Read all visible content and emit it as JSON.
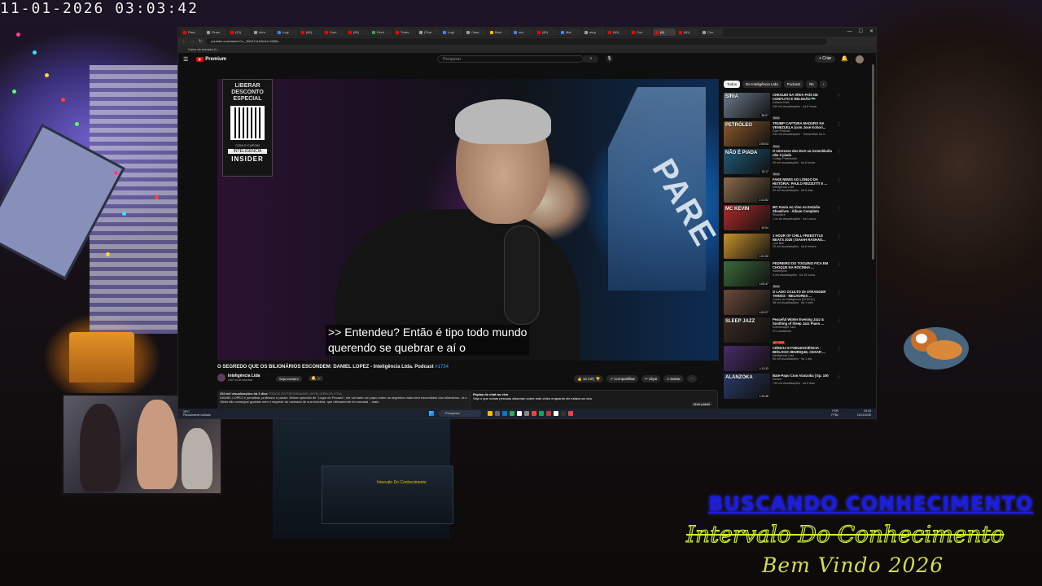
{
  "scene": {
    "timestamp": "11-01-2026 03:03:42",
    "overlay_line1": "BUSCANDO CONHECIMENTO",
    "overlay_line2": "Intervalo Do Conhecimento",
    "overlay_line3": "Bem Vindo 2026",
    "desk_monitor_text": "Intervalo Do Conhecimento"
  },
  "browser": {
    "tabs": [
      {
        "label": "Para",
        "icon": "youtube-icon",
        "color": "#ff0000"
      },
      {
        "label": "Finan",
        "icon": "page-icon",
        "color": "#9aa0a6"
      },
      {
        "label": "(23)",
        "icon": "youtube-icon",
        "color": "#ff0000"
      },
      {
        "label": "Intro",
        "icon": "page-icon",
        "color": "#9aa0a6"
      },
      {
        "label": "Logi",
        "icon": "page-icon",
        "color": "#4285f4"
      },
      {
        "label": "(80)",
        "icon": "youtube-icon",
        "color": "#ff0000"
      },
      {
        "label": "Com",
        "icon": "youtube-icon",
        "color": "#ff0000"
      },
      {
        "label": "(80)",
        "icon": "youtube-icon",
        "color": "#ff0000"
      },
      {
        "label": "Escri",
        "icon": "page-icon",
        "color": "#34a853"
      },
      {
        "label": "Trans",
        "icon": "youtube-icon",
        "color": "#ff0000"
      },
      {
        "label": "(Tina",
        "icon": "page-icon",
        "color": "#9aa0a6"
      },
      {
        "label": "Logi",
        "icon": "page-icon",
        "color": "#4285f4"
      },
      {
        "label": "Casa",
        "icon": "page-icon",
        "color": "#9aa0a6"
      },
      {
        "label": "Bem",
        "icon": "page-icon",
        "color": "#fbbc05"
      },
      {
        "label": "soc",
        "icon": "page-icon",
        "color": "#4285f4"
      },
      {
        "label": "(80)",
        "icon": "youtube-icon",
        "color": "#ff0000"
      },
      {
        "label": "Mal",
        "icon": "page-icon",
        "color": "#4285f4"
      },
      {
        "label": "aw.p",
        "icon": "page-icon",
        "color": "#9aa0a6"
      },
      {
        "label": "(80)",
        "icon": "youtube-icon",
        "color": "#ff0000"
      },
      {
        "label": "Con",
        "icon": "youtube-icon",
        "color": "#ff0000"
      },
      {
        "label": "(8)",
        "icon": "youtube-icon",
        "color": "#ff0000",
        "active": true
      },
      {
        "label": "(80)",
        "icon": "youtube-icon",
        "color": "#ff0000"
      },
      {
        "label": "Con",
        "icon": "page-icon",
        "color": "#9aa0a6"
      }
    ],
    "url": "youtube.com/watch?v=_RW474LN9c&t=1580s",
    "bookmark": "Caixa de entrada (1..."
  },
  "youtube": {
    "logo_text": "Premium",
    "search_placeholder": "Pesquisar",
    "create_label": "+ Criar",
    "notifications_badge": "9+",
    "video": {
      "promo_title": "LIBERAR DESCONTO ESPECIAL",
      "promo_coupon_label": "COM O CUPOM",
      "promo_coupon": "INTELIGÊNCIA",
      "promo_brand": "INSIDER",
      "sign_text": "PARE",
      "caption_line1": ">> Entendeu? Então é tipo todo mundo",
      "caption_line2": "querendo se quebrar e aí o"
    },
    "title": "O SEGREDO QUE OS BILIONÁRIOS ESCONDEM: DANIEL LOPEZ - Inteligência Ltda. Podcast",
    "title_tag": "#1734",
    "channel": "Inteligência Ltda",
    "subscribers": "5,83 mi de inscritos",
    "member_label": "Seja membro",
    "actions": {
      "likes": "12 mil",
      "share": "Compartilhar",
      "clip": "Clipe",
      "save": "Salvar"
    },
    "description": {
      "meta": "334 mil visualizações  há 3 dias",
      "hashtags": "TODOS OS PROGRAMAS | INTELIGÊNCIA LTDA",
      "text": "DANIEL LOPEZ é jornalista, professor e pastor. Nesse episódio de \"Lugar do Pecado\", ele vai bater um papo sobre os segredos mais bem escondidos dos bilionários. Já o Vilela não consegue guardar nem o segredo do cadeado de sua bicicleta, que ultimamente foi roubada ...mais"
    },
    "chat": {
      "title": "Replay do chat ao vivo",
      "text": "Veja o que outras pessoas disseram sobre este vídeo enquanto ele estava ao vivo.",
      "open_label": "Abrir painel"
    },
    "chips": [
      "Todos",
      "De Inteligência Ltda",
      "Podcast",
      "Re"
    ],
    "recommendations": [
      {
        "title": "CHEGUEI NA SÍRIA PAÍS DE CONFLITO E RELIGIÃO 🇸🇾",
        "channel": "Voltaria Ratô",
        "views": "349 mil visualizações · há 8 horas",
        "badge": "Novo",
        "duration": "38:07",
        "thumb_text": "SÍRIA",
        "thumb_color": "#6a7a8c"
      },
      {
        "title": "TRUMP CAPTURA MADURO NA VENEZUELA (com José Kobori...",
        "channel": "Flow Podcast",
        "views": "234 mil visualizações · Transmitido há 3...",
        "badge": "Novo",
        "duration": "2:05:03",
        "thumb_text": "PETRÓLEO",
        "thumb_color": "#8a5a2a"
      },
      {
        "title": "O Interesse dos EUA na Groenlândia não é piada",
        "channel": "Código Pixelúmbio",
        "views": "49 mil visualizações · há 8 horas",
        "badge": "Novo",
        "duration": "15:17",
        "thumb_text": "NÃO É PIADA",
        "thumb_color": "#1f5a7a"
      },
      {
        "title": "FAKE NEWS AO LONGO DA HISTÓRIA: PAULO REZZUTTI E ...",
        "channel": "Inteligência Ltda",
        "views": "92 mil visualizações · há 5 dias",
        "badge": "",
        "duration": "2:41:52",
        "thumb_text": "",
        "thumb_color": "#8a6a4a"
      },
      {
        "title": "MC Kevin Ao Vivo no Estúdio Showlivre - Álbum Completo",
        "channel": "Showlivre",
        "views": "1 mi de visualizações · há 4 anos",
        "badge": "",
        "duration": "43:04",
        "thumb_text": "MC KEVIN",
        "thumb_color": "#b02a2a"
      },
      {
        "title": "1 HOUR OF CHILL FREESTYLE BEATS 2025 | ISAIAH RASHAD...",
        "channel": "Low Bee",
        "views": "25 mil visualizações · há 6 meses",
        "badge": "",
        "duration": "1:01:30",
        "thumb_text": "",
        "thumb_color": "#c8922a"
      },
      {
        "title": "PEDREIRO DO TOGUINO FICA EM CHOQUE NA ROCINHA ...",
        "channel": "nicliemylon",
        "views": "5 mil visualizações · há 15 horas",
        "badge": "Novo",
        "duration": "1:03:47",
        "thumb_text": "",
        "thumb_color": "#3a6a3a"
      },
      {
        "title": "O LADO OCULTO de STRANGER THINGS - MELHORES ...",
        "channel": "Cortes do Inteligência [OFICIAL]",
        "views": "58 mil visualizações · há 1 mês",
        "badge": "",
        "duration": "1:03:27",
        "thumb_text": "",
        "thumb_color": "#6a4a3a"
      },
      {
        "title": "Peaceful Winter Evening Jazz & Soothing of Sleep Jazz Piano ...",
        "channel": "Dreamscape Jazz",
        "views": "372 assistindo",
        "badge": "AO VIVO",
        "duration": "",
        "thumb_text": "SLEEP JAZZ",
        "thumb_color": "#3a2a22"
      },
      {
        "title": "CIÊNCIA E PSEUDOCIÊNCIA - BIÓLOGO HENRIQUE, CESAR ...",
        "channel": "Inteligência Ltda",
        "views": "56 mil visualizações · há 1 dia",
        "badge": "",
        "duration": "1:13:33",
        "thumb_text": "",
        "thumb_color": "#4a2a6a"
      },
      {
        "title": "Bate-Papo Com Alanzoka | Ep. 100",
        "channel": "Defcon",
        "views": "744 mil visualizações · há 5 dias",
        "badge": "",
        "duration": "1:23:48",
        "thumb_text": "ALANZOKA",
        "thumb_color": "#2a3a6a"
      }
    ]
  },
  "taskbar": {
    "weather_temp": "28°C",
    "weather_desc": "Parcialmente nublado",
    "search_label": "Pesquisar",
    "lang": "POR PTB2",
    "time": "03:03",
    "date": "11/01/2026"
  }
}
